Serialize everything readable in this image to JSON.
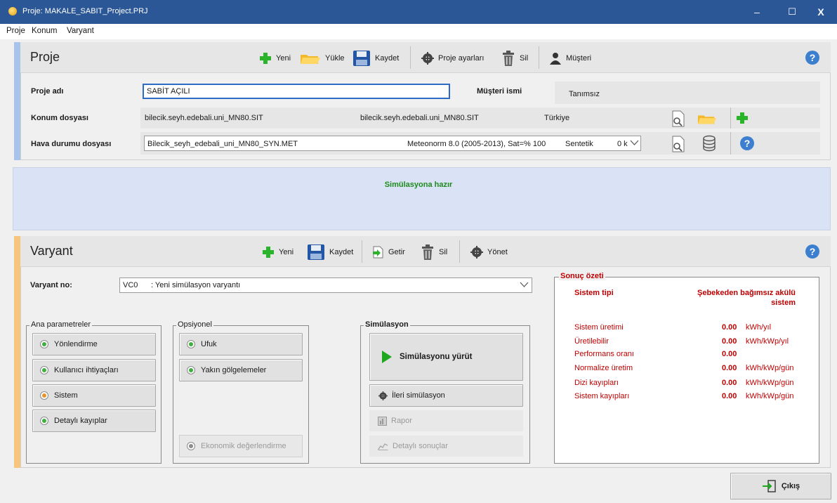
{
  "window": {
    "title": "Proje:  MAKALE_SABIT_Project.PRJ",
    "min": "–",
    "max": "☐",
    "close": "X"
  },
  "menu": [
    "Proje",
    "Konum",
    "Varyant"
  ],
  "project": {
    "title": "Proje",
    "toolbar": {
      "new": "Yeni",
      "load": "Yükle",
      "save": "Kaydet",
      "settings": "Proje ayarları",
      "delete": "Sil",
      "customer": "Müşteri"
    },
    "name_label": "Proje adı",
    "name_value": "SABİT AÇILI",
    "customer_label": "Müşteri ismi",
    "customer_value": "Tanımsız",
    "site_label": "Konum dosyası",
    "site_file": "bilecik.seyh.edebali.uni_MN80.SIT",
    "site_file2": "bilecik.seyh.edebali.uni_MN80.SIT",
    "site_country": "Türkiye",
    "meteo_label": "Hava durumu dosyası",
    "meteo_file": "Bilecik_seyh_edebali_uni_MN80_SYN.MET",
    "meteo_source": "Meteonorm 8.0 (2005-2013), Sat=% 100",
    "meteo_type": "Sentetik",
    "meteo_dist": "0 k"
  },
  "status": {
    "message": "Simülasyona hazır",
    "color": "#1e8a1e"
  },
  "variant": {
    "title": "Varyant",
    "toolbar": {
      "new": "Yeni",
      "save": "Kaydet",
      "import": "Getir",
      "delete": "Sil",
      "manage": "Yönet"
    },
    "no_label": "Varyant no:",
    "no_code": "VC0",
    "no_desc": ": Yeni simülasyon varyantı",
    "main_params": {
      "title": "Ana parametreler",
      "items": [
        {
          "label": "Yönlendirme",
          "state": "green"
        },
        {
          "label": "Kullanıcı ihtiyaçları",
          "state": "green"
        },
        {
          "label": "Sistem",
          "state": "orange"
        },
        {
          "label": "Detaylı kayıplar",
          "state": "green"
        }
      ]
    },
    "optional": {
      "title": "Opsiyonel",
      "items": [
        {
          "label": "Ufuk",
          "state": "green"
        },
        {
          "label": "Yakın gölgelemeler",
          "state": "green"
        }
      ],
      "econ": "Ekonomik değerlendirme"
    },
    "simulation": {
      "title": "Simülasyon",
      "run": "Simülasyonu yürüt",
      "advanced": "İleri simülasyon",
      "report": "Rapor",
      "detailed": "Detaylı sonuçlar"
    },
    "summary": {
      "title": "Sonuç özeti",
      "system_type_label": "Sistem tipi",
      "system_type_value_1": "Şebekeden bağımsız akülü",
      "system_type_value_2": "sistem",
      "rows": [
        {
          "label": "Sistem üretimi",
          "value": "0.00",
          "unit": "kWh/yıl"
        },
        {
          "label": "Üretilebilir",
          "value": "0.00",
          "unit": "kWh/kWp/yıl"
        },
        {
          "label": "Performans oranı",
          "value": "0.00",
          "unit": ""
        },
        {
          "label": "Normalize üretim",
          "value": "0.00",
          "unit": "kWh/kWp/gün"
        },
        {
          "label": "Dizi kayıpları",
          "value": "0.00",
          "unit": "kWh/kWp/gün"
        },
        {
          "label": "Sistem kayıpları",
          "value": "0.00",
          "unit": "kWh/kWp/gün"
        }
      ]
    }
  },
  "exit": "Çıkış",
  "colors": {
    "titlebar": "#2b5797",
    "accent_project": "#a9c4ea",
    "accent_variant": "#f7c57e",
    "status_bg": "#d9e3f5",
    "summary_red": "#c00000"
  }
}
